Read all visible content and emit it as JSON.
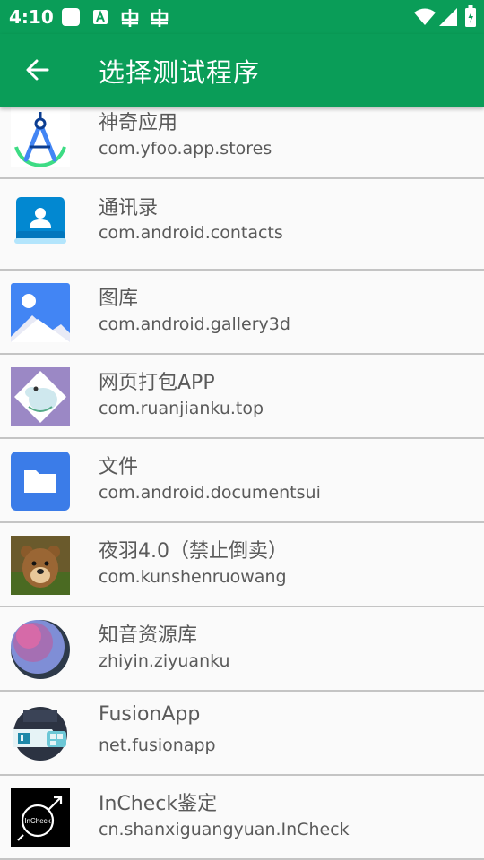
{
  "status_bar": {
    "time": "4:10",
    "icons": [
      "white-square-icon",
      "android-a-icon",
      "bug-icon",
      "bug-icon",
      "wifi-icon",
      "signal-icon",
      "battery-icon"
    ]
  },
  "app_bar": {
    "back_icon": "arrow-back-icon",
    "title": "选择测试程序"
  },
  "colors": {
    "primary": "#0a9d58",
    "divider": "#c4c4c4",
    "text": "#5a5a5a",
    "background": "#fafafa"
  },
  "apps": [
    {
      "name": "神奇应用",
      "package": "com.yfoo.app.stores",
      "icon": "compass-app-icon"
    },
    {
      "name": "通讯录",
      "package": "com.android.contacts",
      "icon": "contacts-icon"
    },
    {
      "name": "图库",
      "package": "com.android.gallery3d",
      "icon": "gallery-icon"
    },
    {
      "name": "网页打包APP",
      "package": "com.ruanjianku.top",
      "icon": "moomin-icon"
    },
    {
      "name": "文件",
      "package": "com.android.documentsui",
      "icon": "folder-icon"
    },
    {
      "name": "夜羽4.0（禁止倒卖）",
      "package": "com.kunshenruowang",
      "icon": "bear-avatar-icon"
    },
    {
      "name": "知音资源库",
      "package": "zhiyin.ziyuanku",
      "icon": "planet-icon"
    },
    {
      "name": "FusionApp",
      "package": "net.fusionapp",
      "icon": "fusionapp-icon"
    },
    {
      "name": "InCheck鉴定",
      "package": "cn.shanxiguangyuan.InCheck",
      "icon": "incheck-icon"
    }
  ]
}
